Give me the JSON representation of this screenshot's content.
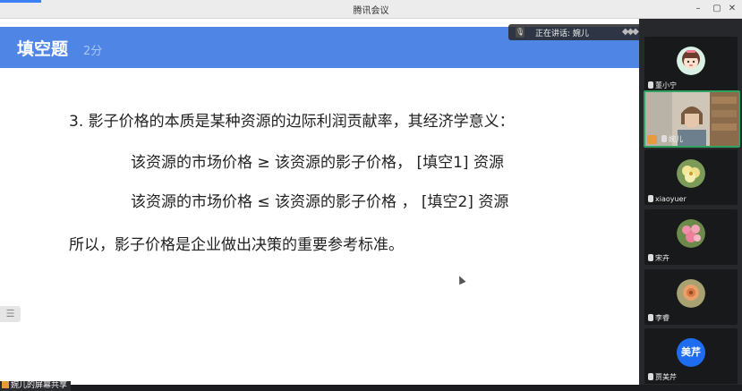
{
  "window": {
    "title": "腾讯会议",
    "minimize": "–",
    "restore": "▢",
    "close": "✕"
  },
  "slide": {
    "title": "填空题",
    "score": "2分",
    "lines": [
      "3. 影子价格的本质是某种资源的边际利润贡献率，其经济学意义：",
      "该资源的市场价格 ≥ 该资源的影子价格，  [填空1] 资源",
      "该资源的市场价格 ≤ 该资源的影子价格 ，  [填空2] 资源",
      "所以，影子价格是企业做出决策的重要参考标准。"
    ],
    "menu_glyph": "☰"
  },
  "speaking": {
    "label": "正在讲话: 婉儿"
  },
  "participants": [
    {
      "name": "董小宁",
      "avatar": "girl-cartoon"
    },
    {
      "name": "婉儿",
      "avatar": "camera-video"
    },
    {
      "name": "xiaoyuer",
      "avatar": "flower-yellow"
    },
    {
      "name": "宋卉",
      "avatar": "flower-pink"
    },
    {
      "name": "李睿",
      "avatar": "flower-orange"
    },
    {
      "name": "贾美芹",
      "avatar_text": "美芹"
    }
  ],
  "share": {
    "label": "婉儿的屏幕共享"
  }
}
